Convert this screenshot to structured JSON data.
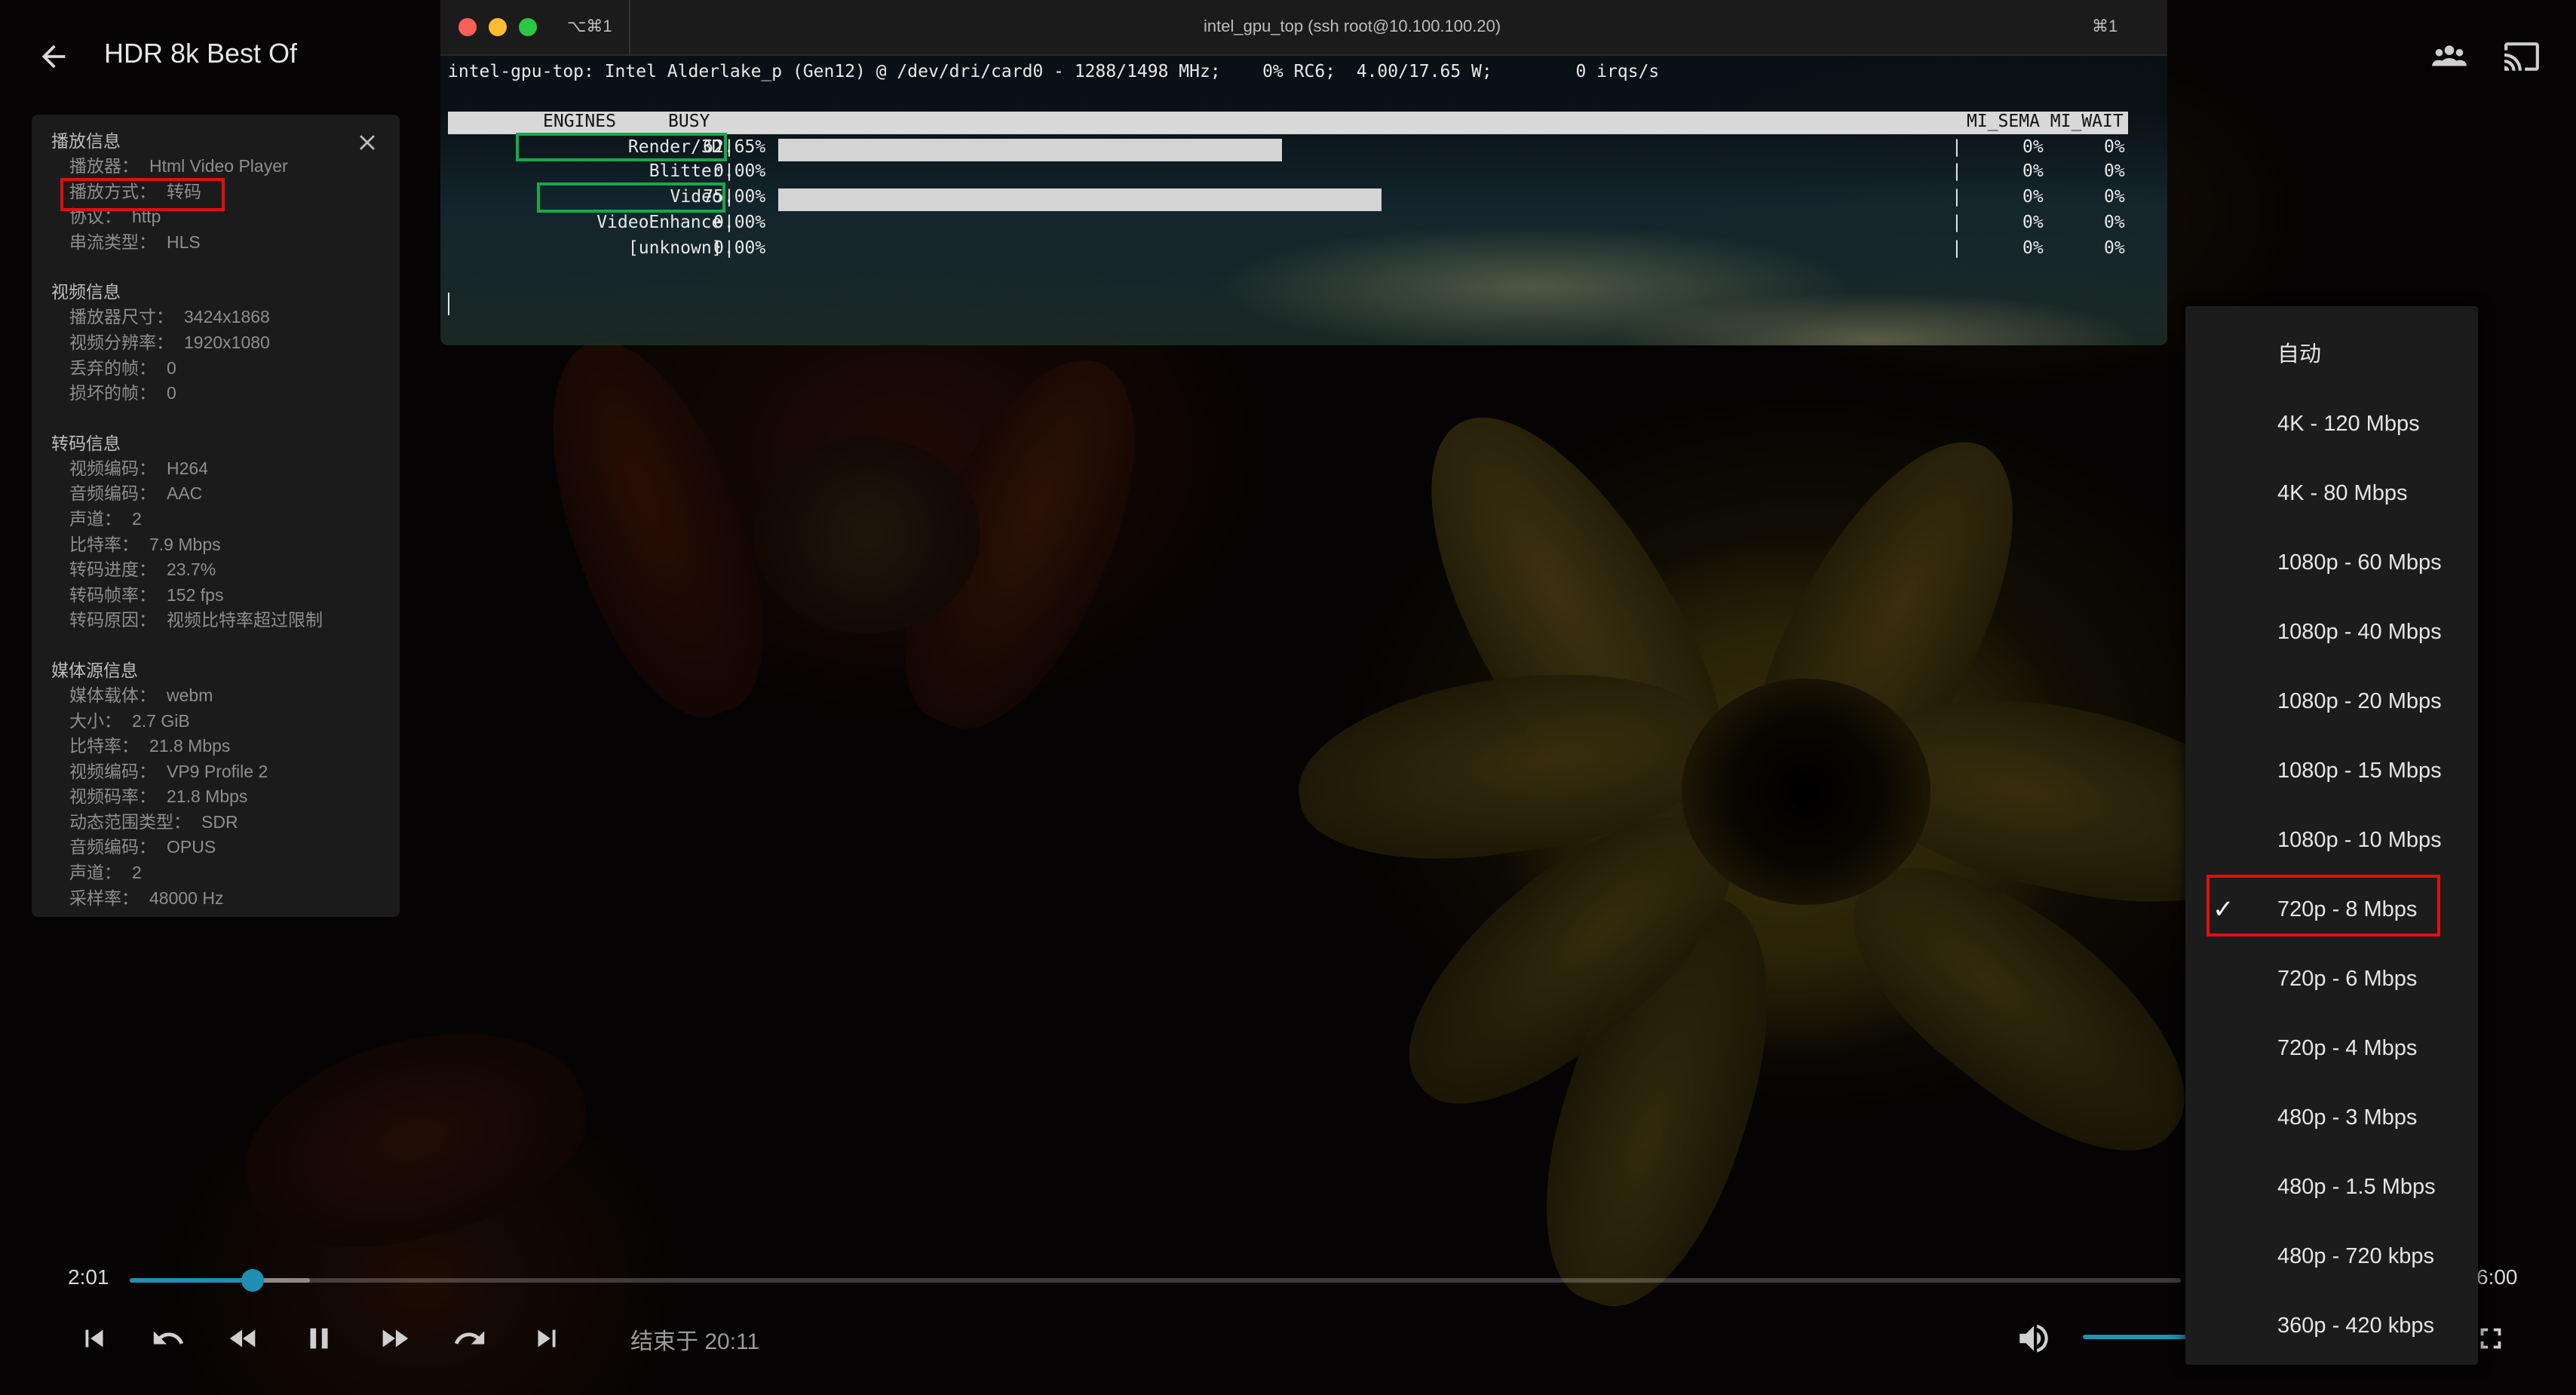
{
  "header": {
    "title": "HDR 8k Best Of",
    "back_icon": "arrow-left-icon",
    "right_icons": [
      "group-icon",
      "cast-icon"
    ]
  },
  "info_panel": {
    "sections": [
      {
        "title": "播放信息",
        "rows": [
          {
            "label": "播放器：",
            "value": "Html Video Player"
          },
          {
            "label": "播放方式：",
            "value": "转码"
          },
          {
            "label": "协议：",
            "value": "http"
          },
          {
            "label": "串流类型：",
            "value": "HLS"
          }
        ]
      },
      {
        "title": "视频信息",
        "rows": [
          {
            "label": "播放器尺寸：",
            "value": "3424x1868"
          },
          {
            "label": "视频分辨率：",
            "value": "1920x1080"
          },
          {
            "label": "丢弃的帧：",
            "value": "0"
          },
          {
            "label": "损坏的帧：",
            "value": "0"
          }
        ]
      },
      {
        "title": "转码信息",
        "rows": [
          {
            "label": "视频编码：",
            "value": "H264"
          },
          {
            "label": "音频编码：",
            "value": "AAC"
          },
          {
            "label": "声道：",
            "value": "2"
          },
          {
            "label": "比特率：",
            "value": "7.9 Mbps"
          },
          {
            "label": "转码进度：",
            "value": "23.7%"
          },
          {
            "label": "转码帧率：",
            "value": "152 fps"
          },
          {
            "label": "转码原因：",
            "value": "视频比特率超过限制"
          }
        ]
      },
      {
        "title": "媒体源信息",
        "rows": [
          {
            "label": "媒体载体：",
            "value": "webm"
          },
          {
            "label": "大小：",
            "value": "2.7 GiB"
          },
          {
            "label": "比特率：",
            "value": "21.8 Mbps"
          },
          {
            "label": "视频编码：",
            "value": "VP9 Profile 2"
          },
          {
            "label": "视频码率：",
            "value": "21.8 Mbps"
          },
          {
            "label": "动态范围类型：",
            "value": "SDR"
          },
          {
            "label": "音频编码：",
            "value": "OPUS"
          },
          {
            "label": "声道：",
            "value": "2"
          },
          {
            "label": "采样率：",
            "value": "48000 Hz"
          }
        ]
      }
    ]
  },
  "terminal": {
    "tab_shortcut": "⌥⌘1",
    "window_title": "intel_gpu_top (ssh root@10.100.100.20)",
    "window_shortcut": "⌘1",
    "status_line": "intel-gpu-top: Intel Alderlake_p (Gen12) @ /dev/dri/card0 - 1288/1498 MHz;    0% RC6;  4.00/17.65 W;        0 irqs/s",
    "col_engines": "ENGINES",
    "col_busy": "BUSY",
    "col_mi": "MI_SEMA MI_WAIT",
    "engines": [
      {
        "name": "Render/3D",
        "busy": "62.65%",
        "busy_value": 62.65,
        "sema": "0%",
        "wait": "0%"
      },
      {
        "name": "Blitter",
        "busy": "0.00%",
        "busy_value": 0.0,
        "sema": "0%",
        "wait": "0%"
      },
      {
        "name": "Video",
        "busy": "75.00%",
        "busy_value": 75.0,
        "sema": "0%",
        "wait": "0%"
      },
      {
        "name": "VideoEnhance",
        "busy": "0.00%",
        "busy_value": 0.0,
        "sema": "0%",
        "wait": "0%"
      },
      {
        "name": "[unknown]",
        "busy": "0.00%",
        "busy_value": 0.0,
        "sema": "0%",
        "wait": "0%"
      }
    ]
  },
  "player": {
    "current_time": "2:01",
    "end_time_label": "结束于 20:11",
    "duration_partial": "6:00",
    "progress_fraction": 0.06,
    "buffer_fraction": 0.088
  },
  "controls": [
    "skip-previous-icon",
    "replay-icon",
    "rewind-icon",
    "pause-icon",
    "fast-forward-icon",
    "forward-icon",
    "skip-next-icon"
  ],
  "quality_menu": {
    "items": [
      "自动",
      "4K - 120 Mbps",
      "4K - 80 Mbps",
      "1080p - 60 Mbps",
      "1080p - 40 Mbps",
      "1080p - 20 Mbps",
      "1080p - 15 Mbps",
      "1080p - 10 Mbps",
      "720p - 8 Mbps",
      "720p - 6 Mbps",
      "720p - 4 Mbps",
      "480p - 3 Mbps",
      "480p - 1.5 Mbps",
      "480p - 720 kbps",
      "360p - 420 kbps"
    ],
    "selected_index": 8
  },
  "colors": {
    "accent": "#1f8fb3",
    "highlight_red": "#e01010",
    "highlight_green": "#1aa84a"
  }
}
